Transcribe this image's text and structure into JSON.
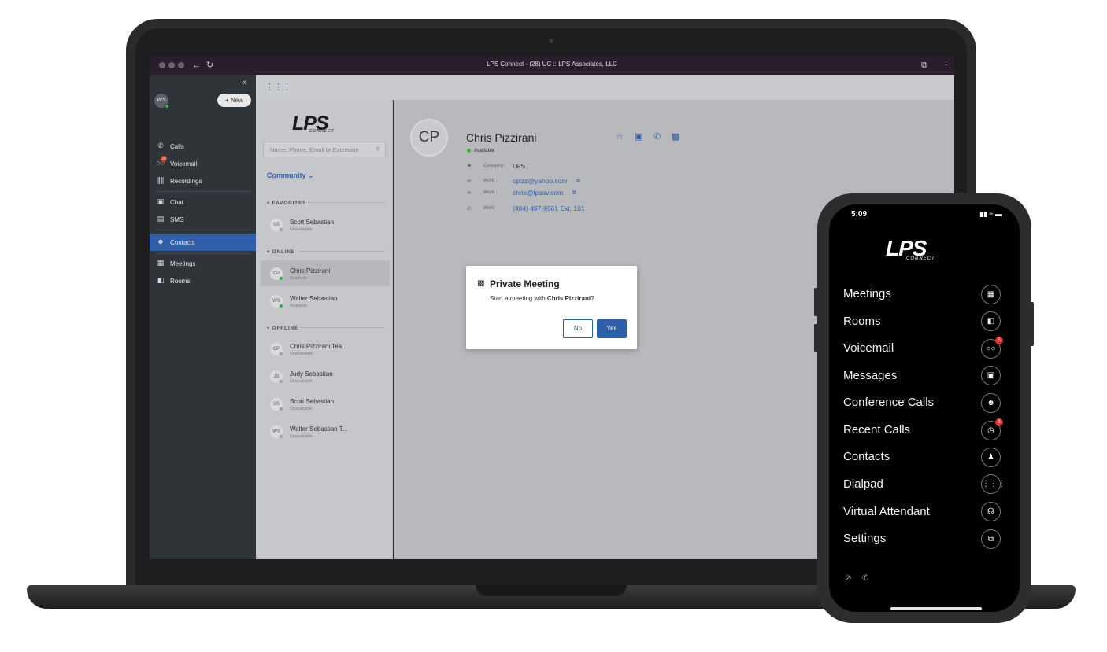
{
  "browser": {
    "title": "LPS Connect - (28) UC :: LPS Associates, LLC"
  },
  "app": {
    "user_initials": "WS",
    "new_button": "+ New",
    "nav": [
      {
        "label": "Calls",
        "icon": "phone-icon"
      },
      {
        "label": "Voicemail",
        "icon": "voicemail-icon",
        "badge": "28"
      },
      {
        "label": "Recordings",
        "icon": "waveform-icon"
      },
      {
        "label": "Chat",
        "icon": "chat-icon"
      },
      {
        "label": "SMS",
        "icon": "sms-icon"
      },
      {
        "label": "Contacts",
        "icon": "contacts-icon",
        "active": true
      },
      {
        "label": "Meetings",
        "icon": "calendar-icon"
      },
      {
        "label": "Rooms",
        "icon": "door-icon"
      }
    ]
  },
  "logo": {
    "text": "LPS",
    "sub": "CONNECT"
  },
  "contacts": {
    "search_placeholder": "Name, Phone, Email or Extension",
    "group": "Community",
    "sections": {
      "favorites": "FAVORITES",
      "online": "ONLINE",
      "offline": "OFFLINE"
    },
    "favorites": [
      {
        "initials": "SS",
        "name": "Scott Sebastian",
        "status": "Unavailable"
      }
    ],
    "online": [
      {
        "initials": "CP",
        "name": "Chris Pizzirani",
        "status": "Available"
      },
      {
        "initials": "WS",
        "name": "Walter Sebastian",
        "status": "Available"
      }
    ],
    "offline": [
      {
        "initials": "CP",
        "name": "Chris Pizzirani Tea...",
        "status": "Unavailable"
      },
      {
        "initials": "JS",
        "name": "Judy Sebastian",
        "status": "Unavailable"
      },
      {
        "initials": "SS",
        "name": "Scott Sebastian",
        "status": "Unavailable"
      },
      {
        "initials": "WS",
        "name": "Walter Sebastian T...",
        "status": "Unavailable"
      }
    ]
  },
  "detail": {
    "initials": "CP",
    "name": "Chris Pizzirani",
    "status": "Available",
    "company_label": "Company:",
    "company": "LPS",
    "work_label_1": "Work :",
    "email_1": "cpizz@yahoo.com",
    "work_label_2": "Work :",
    "email_2": "chris@lpsav.com",
    "work_label_3": "Work:",
    "phone": "(484) 497-9561 Ext. 101"
  },
  "modal": {
    "title": "Private Meeting",
    "body_prefix": "Start a meeting with ",
    "body_name": "Chris Pizzirani",
    "body_suffix": "?",
    "no": "No",
    "yes": "Yes"
  },
  "phone": {
    "time": "5:09",
    "menu": [
      {
        "label": "Meetings",
        "icon": "calendar-icon"
      },
      {
        "label": "Rooms",
        "icon": "door-icon"
      },
      {
        "label": "Voicemail",
        "icon": "voicemail-icon",
        "badge": "5"
      },
      {
        "label": "Messages",
        "icon": "chat-icon"
      },
      {
        "label": "Conference Calls",
        "icon": "group-icon"
      },
      {
        "label": "Recent Calls",
        "icon": "clock-icon",
        "badge": "3"
      },
      {
        "label": "Contacts",
        "icon": "person-icon"
      },
      {
        "label": "Dialpad",
        "icon": "dialpad-icon"
      },
      {
        "label": "Virtual Attendant",
        "icon": "headset-icon"
      },
      {
        "label": "Settings",
        "icon": "logout-icon"
      }
    ]
  },
  "colors": {
    "accent": "#2f5fa8",
    "available": "#3fae49",
    "badge": "#d9342b"
  }
}
